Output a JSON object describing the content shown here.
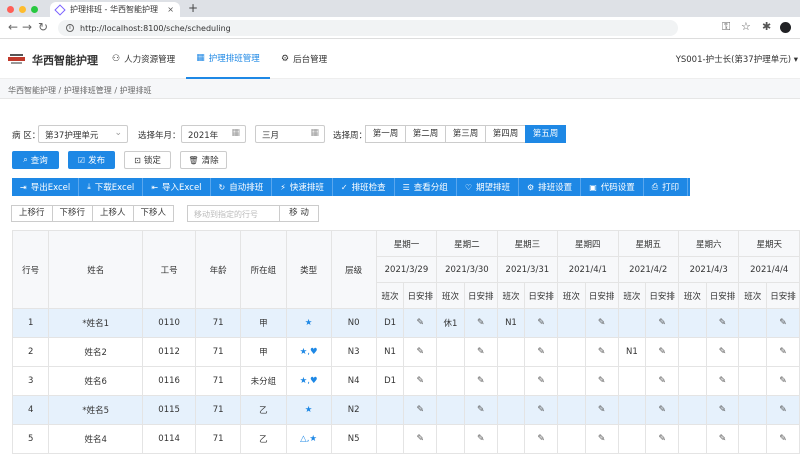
{
  "browser": {
    "tab_title": "护理排班 - 华西智能护理",
    "tab_close": "×",
    "new_tab": "+",
    "url": "http://localhost:8100/sche/scheduling"
  },
  "app": {
    "name": "华西智能护理",
    "menu": [
      {
        "label": "人力资源管理",
        "icon": "people-icon",
        "glyph": "⚇"
      },
      {
        "label": "护理排班管理",
        "icon": "calendar-icon",
        "glyph": "▦"
      },
      {
        "label": "后台管理",
        "icon": "gear-icon",
        "glyph": "⚙"
      }
    ],
    "user": "YS001-护士长(第37护理单元)",
    "user_caret": "▾"
  },
  "breadcrumb": [
    "华西智能护理",
    "护理排班管理",
    "护理排班"
  ],
  "breadcrumb_sep": " / ",
  "filters": {
    "ward_label": "病 区：",
    "ward_value": "第37护理单元",
    "year_label": "选择年月：",
    "year_value": "2021年",
    "month_value": "三月",
    "week_label": "选择周：",
    "weeks": [
      "第一周",
      "第二周",
      "第三周",
      "第四周",
      "第五周"
    ],
    "active_week": "第五周"
  },
  "actions": {
    "query": "查询",
    "publish": "发布",
    "lock": "锁定",
    "clear": "清除"
  },
  "toolbar": [
    {
      "label": "导出Excel",
      "icon": "export-icon",
      "glyph": "⇥"
    },
    {
      "label": "下载Excel",
      "icon": "download-icon",
      "glyph": "⤓"
    },
    {
      "label": "导入Excel",
      "icon": "import-icon",
      "glyph": "⇤"
    },
    {
      "label": "自动排班",
      "icon": "refresh-icon",
      "glyph": "↻"
    },
    {
      "label": "快速排班",
      "icon": "lightning-icon",
      "glyph": "⚡"
    },
    {
      "label": "排班检查",
      "icon": "check-icon",
      "glyph": "✓"
    },
    {
      "label": "查看分组",
      "icon": "list-icon",
      "glyph": "☰"
    },
    {
      "label": "期望排班",
      "icon": "heart-icon",
      "glyph": "♡"
    },
    {
      "label": "排班设置",
      "icon": "gear-icon",
      "glyph": "⚙"
    },
    {
      "label": "代码设置",
      "icon": "code-icon",
      "glyph": "▣"
    },
    {
      "label": "打印",
      "icon": "printer-icon",
      "glyph": "⎙"
    }
  ],
  "row_controls": {
    "move_up": "上移行",
    "move_down": "下移行",
    "move_person_up": "上移人",
    "move_person_down": "下移人",
    "goto_placeholder": "移动到指定的行号",
    "goto_button": "移 动"
  },
  "table": {
    "headers": {
      "row_no": "行号",
      "name": "姓名",
      "staff_no": "工号",
      "age": "年龄",
      "group": "所在组",
      "type": "类型",
      "level": "层级"
    },
    "days": [
      {
        "weekday": "星期一",
        "date": "2021/3/29"
      },
      {
        "weekday": "星期二",
        "date": "2021/3/30"
      },
      {
        "weekday": "星期三",
        "date": "2021/3/31"
      },
      {
        "weekday": "星期四",
        "date": "2021/4/1"
      },
      {
        "weekday": "星期五",
        "date": "2021/4/2"
      },
      {
        "weekday": "星期六",
        "date": "2021/4/3"
      },
      {
        "weekday": "星期天",
        "date": "2021/4/4"
      }
    ],
    "sub_headers": [
      "班次",
      "日安排"
    ],
    "edit_glyph": "✎",
    "rows": [
      {
        "no": "1",
        "name": "*姓名1",
        "staff": "0110",
        "age": "71",
        "group": "甲",
        "type": "★",
        "level": "N0",
        "shifts": [
          "D1",
          "休1",
          "N1",
          "",
          "",
          "",
          ""
        ],
        "highlight": true
      },
      {
        "no": "2",
        "name": "姓名2",
        "staff": "0112",
        "age": "71",
        "group": "甲",
        "type": "★,♥",
        "level": "N3",
        "shifts": [
          "N1",
          "",
          "",
          "",
          "N1",
          "",
          ""
        ],
        "highlight": false
      },
      {
        "no": "3",
        "name": "姓名6",
        "staff": "0116",
        "age": "71",
        "group": "未分组",
        "type": "★,♥",
        "level": "N4",
        "shifts": [
          "D1",
          "",
          "",
          "",
          "",
          "",
          ""
        ],
        "highlight": false
      },
      {
        "no": "4",
        "name": "*姓名5",
        "staff": "0115",
        "age": "71",
        "group": "乙",
        "type": "★",
        "level": "N2",
        "shifts": [
          "",
          "",
          "",
          "",
          "",
          "",
          ""
        ],
        "highlight": true
      },
      {
        "no": "5",
        "name": "姓名4",
        "staff": "0114",
        "age": "71",
        "group": "乙",
        "type": "△,★",
        "level": "N5",
        "shifts": [
          "",
          "",
          "",
          "",
          "",
          "",
          ""
        ],
        "highlight": false
      }
    ]
  },
  "colors": {
    "accent": "#1e88e5",
    "row_highlight": "#e6f1fc"
  }
}
